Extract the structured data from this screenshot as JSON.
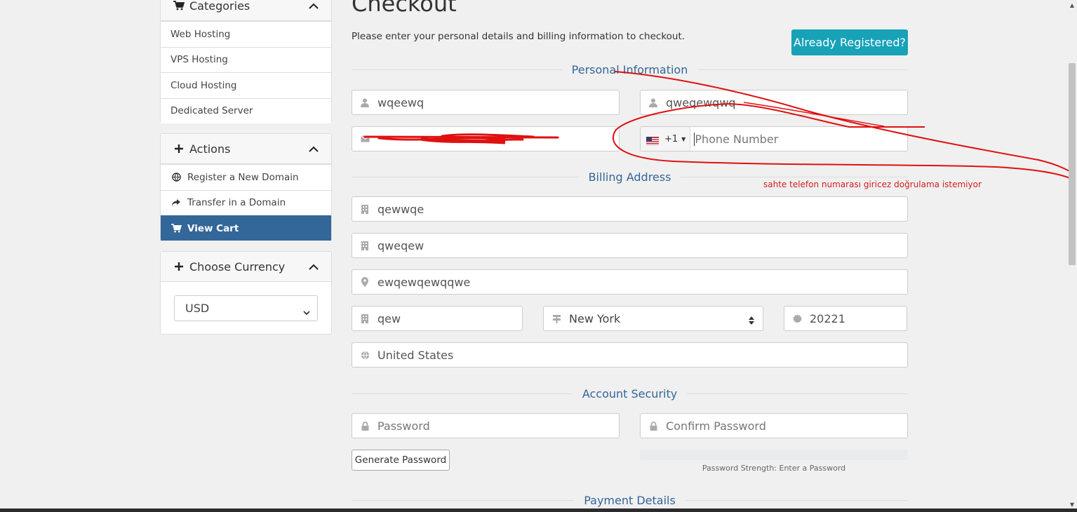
{
  "page": {
    "title": "Checkout",
    "intro": "Please enter your personal details and billing information to checkout.",
    "already_registered": "Already Registered?"
  },
  "sidebar": {
    "categories": {
      "heading": "Categories",
      "items": [
        "Web Hosting",
        "VPS Hosting",
        "Cloud Hosting",
        "Dedicated Server"
      ]
    },
    "actions": {
      "heading": "Actions",
      "items": [
        {
          "label": "Register a New Domain",
          "icon": "globe-icon"
        },
        {
          "label": "Transfer in a Domain",
          "icon": "share-arrow-icon"
        },
        {
          "label": "View Cart",
          "icon": "cart-icon",
          "active": true
        }
      ]
    },
    "currency": {
      "heading": "Choose Currency",
      "selected": "USD"
    }
  },
  "personal": {
    "heading": "Personal Information",
    "first_name": "wqeewq",
    "last_name": "qweqewqwq",
    "email": "",
    "phone_code": "+1",
    "phone_placeholder": "Phone Number"
  },
  "billing": {
    "heading": "Billing Address",
    "company": "qewwqe",
    "address1": "qweqew",
    "address2": "ewqewqewqqwe",
    "city": "qew",
    "state": "New York",
    "postcode": "20221",
    "country": "United States"
  },
  "security": {
    "heading": "Account Security",
    "password_placeholder": "Password",
    "confirm_placeholder": "Confirm Password",
    "generate_label": "Generate Password",
    "strength_text": "Password Strength: Enter a Password"
  },
  "payment": {
    "heading": "Payment Details"
  },
  "annotation": {
    "note": "sahte telefon numarası giricez  doğrulama istemiyor",
    "color": "#e01010"
  },
  "colors": {
    "accent": "#336699",
    "button_info": "#17a2b8"
  }
}
